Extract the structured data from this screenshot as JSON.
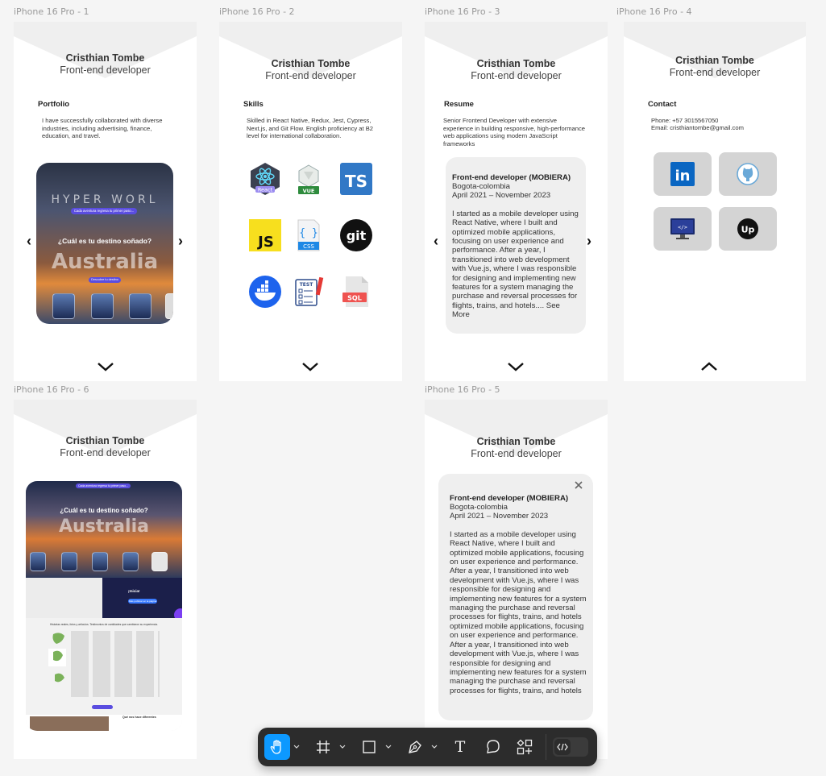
{
  "frames": [
    {
      "label": "iPhone 16 Pro - 1"
    },
    {
      "label": "iPhone 16 Pro - 2"
    },
    {
      "label": "iPhone 16 Pro - 3"
    },
    {
      "label": "iPhone 16 Pro - 4"
    },
    {
      "label": "iPhone 16 Pro - 6"
    },
    {
      "label": "iPhone 16 Pro - 5"
    }
  ],
  "profile": {
    "name": "Cristhian Tombe",
    "role": "Front-end developer"
  },
  "portfolio": {
    "title": "Portfolio",
    "text": "I have successfully collaborated with diverse industries, including advertising, finance, education, and travel.",
    "preview": {
      "brand": "HYPER WORL",
      "pill": "Cada aventura regresa tu primer paso...",
      "question": "¿Cuál es tu destino soñado?",
      "big": "Australia",
      "button": "Descubre tu destino"
    }
  },
  "skills": {
    "title": "Skills",
    "text": "Skilled in React Native, Redux, Jest, Cypress, Next.js, and Git Flow. English proficiency at B2 level for international collaboration.",
    "icons": [
      {
        "name": "react",
        "label": "React"
      },
      {
        "name": "vue",
        "label": "VUE"
      },
      {
        "name": "typescript",
        "label": "TS"
      },
      {
        "name": "javascript",
        "label": "JS"
      },
      {
        "name": "css",
        "label": "CSS"
      },
      {
        "name": "git",
        "label": "git"
      },
      {
        "name": "docker",
        "label": ""
      },
      {
        "name": "test",
        "label": "TEST"
      },
      {
        "name": "sql",
        "label": "SQL"
      }
    ]
  },
  "resume": {
    "title": "Resume",
    "text": "Senior Frontend Developer with extensive experience in building responsive, high-performance web applications using modern JavaScript frameworks",
    "job_title": "Front-end developer (MOBIERA)",
    "location": "Bogota-colombia",
    "period": "April 2021 – November 2023",
    "summary": "I started as a mobile developer using  React Native, where I built and optimized mobile applications, focusing  on user experience and performance. After a year, I transitioned into  web development with Vue.js, where I was responsible for designing and  implementing new features for a system managing the purchase and  reversal processes for flights, trains, and hotels....",
    "see_more": "See More",
    "full_text": "I started as a mobile developer using React Native, where I built and optimized mobile applications, focusing  on user experience and performance. After a year, I transitioned into  web development with Vue.js, where I was responsible for designing and  implementing new features for a system managing the purchase and  reversal processes for flights, trains, and hotels optimized mobile applications, focusing  on user experience and performance. After a year, I transitioned into  web development with Vue.js, where I was responsible for designing and implementing new features for a system managing the purchase and reversal processes for flights, trains, and hotels"
  },
  "contact": {
    "title": "Contact",
    "phone": "Phone: +57 3015567050",
    "email": "Email: cristhiantombe@gmail.com",
    "tiles": [
      {
        "name": "linkedin",
        "label": "in"
      },
      {
        "name": "github",
        "label": ""
      },
      {
        "name": "code-monitor",
        "label": ""
      },
      {
        "name": "upwork",
        "label": "Up"
      }
    ]
  },
  "frame6": {
    "pill": "Cada aventura regresa tu primer paso...",
    "question": "¿Cuál es tu destino soñado?",
    "big": "Australia",
    "side_title": "¡Inicia!",
    "side_btn": "Más publicar en la página",
    "map_title": "Historias reales, fotos y artículos. Testimonios de cantidades que cambiaron su experiencia.",
    "bottom_title": "Qué nos hace diferentes"
  },
  "toolbar": {
    "tools": [
      "hand-tool",
      "frame-tool",
      "rectangle-tool",
      "pen-tool",
      "text-tool",
      "comment-tool",
      "components-tool",
      "dev-mode-toggle"
    ],
    "text_glyph": "T"
  },
  "colors": {
    "accent": "#0d99ff",
    "canvas": "#f5f5f5",
    "card": "#efefef",
    "tile": "#d4d4d4",
    "toolbar": "#2c2c2c"
  }
}
